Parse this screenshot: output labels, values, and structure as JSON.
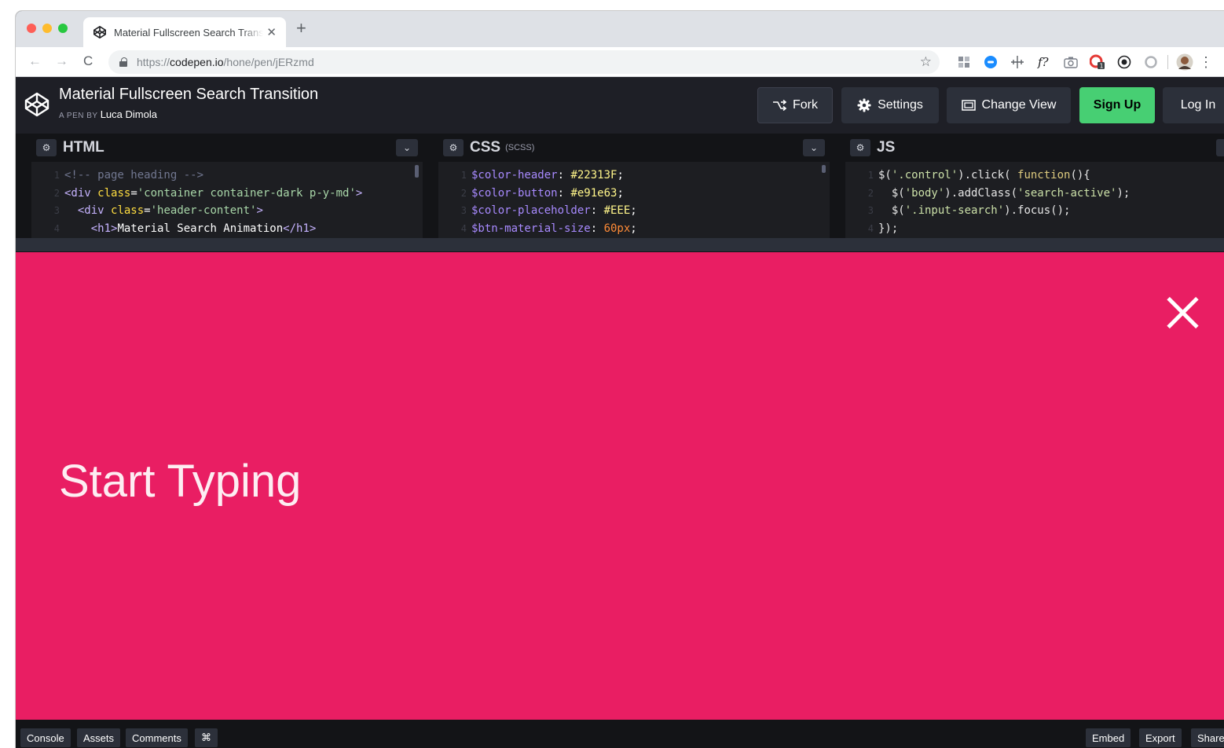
{
  "browser": {
    "tab_title": "Material Fullscreen Search Transition",
    "tab_close": "✕",
    "new_tab": "+",
    "url_scheme": "https://",
    "url_host": "codepen.io",
    "url_path": "/hone/pen/jERzmd",
    "nav": {
      "back": "←",
      "forward": "→",
      "reload": "C"
    },
    "star": "☆",
    "extensions": [
      "grid-icon",
      "circle-blue-icon",
      "crosshair-icon",
      "fx-icon",
      "camera-icon",
      "red-extension-icon",
      "record-icon",
      "ring-icon"
    ],
    "menu": "⋮"
  },
  "pen": {
    "title": "Material Fullscreen Search Transition",
    "by_label": "A PEN BY",
    "author": "Luca Dimola"
  },
  "header_buttons": {
    "fork": "Fork",
    "settings": "Settings",
    "change_view": "Change View",
    "sign_up": "Sign Up",
    "log_in": "Log In"
  },
  "editors": {
    "html": {
      "name": "HTML",
      "lines": [
        {
          "n": "1",
          "parts": [
            [
              "c-cm",
              "<!-- page heading -->"
            ]
          ]
        },
        {
          "n": "2",
          "parts": [
            [
              "c-tag",
              "<div "
            ],
            [
              "c-attr",
              "class"
            ],
            [
              "c-txt",
              "="
            ],
            [
              "c-str",
              "'container container-dark p-y-md'"
            ],
            [
              "c-tag",
              ">"
            ]
          ]
        },
        {
          "n": "3",
          "parts": [
            [
              "c-txt",
              "  "
            ],
            [
              "c-tag",
              "<div "
            ],
            [
              "c-attr",
              "class"
            ],
            [
              "c-txt",
              "="
            ],
            [
              "c-str",
              "'header-content'"
            ],
            [
              "c-tag",
              ">"
            ]
          ]
        },
        {
          "n": "4",
          "parts": [
            [
              "c-txt",
              "    "
            ],
            [
              "c-tag",
              "<h1>"
            ],
            [
              "c-txt",
              "Material Search Animation"
            ],
            [
              "c-tag",
              "</h1>"
            ]
          ]
        }
      ]
    },
    "css": {
      "name": "CSS",
      "sub": "(SCSS)",
      "lines": [
        {
          "n": "1",
          "parts": [
            [
              "c-var",
              "$color-header"
            ],
            [
              "c-col",
              ": "
            ],
            [
              "c-hex",
              "#22313F"
            ],
            [
              "c-col",
              ";"
            ]
          ]
        },
        {
          "n": "2",
          "parts": [
            [
              "c-var",
              "$color-button"
            ],
            [
              "c-col",
              ": "
            ],
            [
              "c-hex",
              "#e91e63"
            ],
            [
              "c-col",
              ";"
            ]
          ]
        },
        {
          "n": "3",
          "parts": [
            [
              "c-var",
              "$color-placeholder"
            ],
            [
              "c-col",
              ": "
            ],
            [
              "c-hex",
              "#EEE"
            ],
            [
              "c-col",
              ";"
            ]
          ]
        },
        {
          "n": "4",
          "parts": [
            [
              "c-var",
              "$btn-material-size"
            ],
            [
              "c-col",
              ": "
            ],
            [
              "c-num",
              "60px"
            ],
            [
              "c-col",
              ";"
            ]
          ]
        }
      ]
    },
    "js": {
      "name": "JS",
      "lines": [
        {
          "n": "1",
          "parts": [
            [
              "c-js",
              "$("
            ],
            [
              "c-jsstr",
              "'.control'"
            ],
            [
              "c-js",
              ").click( "
            ],
            [
              "c-kw",
              "function"
            ],
            [
              "c-js",
              "(){"
            ]
          ]
        },
        {
          "n": "2",
          "parts": [
            [
              "c-js",
              "  $("
            ],
            [
              "c-jsstr",
              "'body'"
            ],
            [
              "c-js",
              ").addClass("
            ],
            [
              "c-jsstr",
              "'search-active'"
            ],
            [
              "c-js",
              ");"
            ]
          ]
        },
        {
          "n": "3",
          "parts": [
            [
              "c-js",
              "  $("
            ],
            [
              "c-jsstr",
              "'.input-search'"
            ],
            [
              "c-js",
              ").focus();"
            ]
          ]
        },
        {
          "n": "4",
          "parts": [
            [
              "c-js",
              "});"
            ]
          ]
        }
      ]
    }
  },
  "preview": {
    "placeholder": "Start Typing",
    "background": "#e91e63"
  },
  "footer": {
    "left": [
      "Console",
      "Assets",
      "Comments",
      "⌘"
    ],
    "right": [
      "Embed",
      "Export",
      "Share"
    ]
  }
}
